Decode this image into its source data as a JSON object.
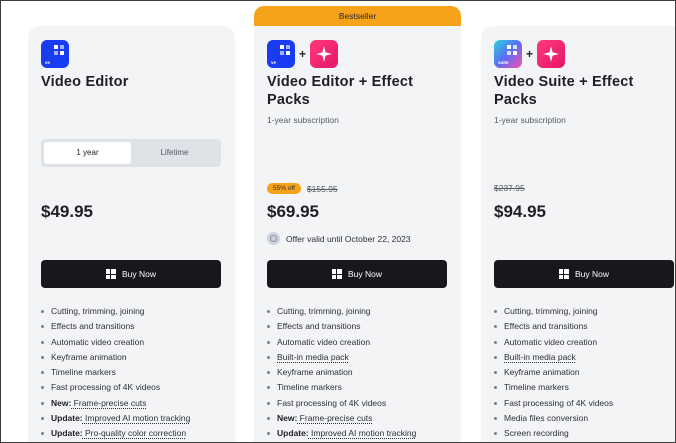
{
  "bestseller_label": "Bestseller",
  "buy_label": "Buy Now",
  "cards": [
    {
      "icon_tags": [
        "ve"
      ],
      "title": "Video Editor",
      "toggle": [
        "1 year",
        "Lifetime"
      ],
      "price": "$49.95",
      "features": [
        {
          "prefix": "",
          "text": "Cutting, trimming, joining",
          "underline": false
        },
        {
          "prefix": "",
          "text": "Effects and transitions",
          "underline": false
        },
        {
          "prefix": "",
          "text": "Automatic video creation",
          "underline": false
        },
        {
          "prefix": "",
          "text": "Keyframe animation",
          "underline": false
        },
        {
          "prefix": "",
          "text": "Timeline markers",
          "underline": false
        },
        {
          "prefix": "",
          "text": "Fast processing of 4K videos",
          "underline": false
        },
        {
          "prefix": "New:",
          "text": " Frame-precise cuts",
          "underline": true
        },
        {
          "prefix": "Update:",
          "text": " Improved AI motion tracking",
          "underline": true
        },
        {
          "prefix": "Update:",
          "text": " Pro-quality color correction",
          "underline": true
        }
      ]
    },
    {
      "icon_tags": [
        "ve"
      ],
      "title": "Video Editor + Effect Packs",
      "subtitle": "1-year subscription",
      "discount_badge": "55% off",
      "old_price": "$155.95",
      "price": "$69.95",
      "offer_text": "Offer valid until October 22, 2023",
      "features": [
        {
          "prefix": "",
          "text": "Cutting, trimming, joining",
          "underline": false
        },
        {
          "prefix": "",
          "text": "Effects and transitions",
          "underline": false
        },
        {
          "prefix": "",
          "text": "Automatic video creation",
          "underline": false
        },
        {
          "prefix": "",
          "text": "Built-in media pack",
          "underline": true
        },
        {
          "prefix": "",
          "text": "Keyframe animation",
          "underline": false
        },
        {
          "prefix": "",
          "text": "Timeline markers",
          "underline": false
        },
        {
          "prefix": "",
          "text": "Fast processing of 4K videos",
          "underline": false
        },
        {
          "prefix": "New:",
          "text": " Frame-precise cuts",
          "underline": true
        },
        {
          "prefix": "Update:",
          "text": " Improved AI motion tracking",
          "underline": true
        }
      ]
    },
    {
      "icon_tags": [
        "suite"
      ],
      "title": "Video Suite + Effect Packs",
      "subtitle": "1-year subscription",
      "old_price": "$237.95",
      "price": "$94.95",
      "features": [
        {
          "prefix": "",
          "text": "Cutting, trimming, joining",
          "underline": false
        },
        {
          "prefix": "",
          "text": "Effects and transitions",
          "underline": false
        },
        {
          "prefix": "",
          "text": "Automatic video creation",
          "underline": false
        },
        {
          "prefix": "",
          "text": "Built-in media pack",
          "underline": true
        },
        {
          "prefix": "",
          "text": "Keyframe animation",
          "underline": false
        },
        {
          "prefix": "",
          "text": "Timeline markers",
          "underline": false
        },
        {
          "prefix": "",
          "text": "Fast processing of 4K videos",
          "underline": false
        },
        {
          "prefix": "",
          "text": "Media files conversion",
          "underline": false
        },
        {
          "prefix": "",
          "text": "Screen recording",
          "underline": false
        }
      ]
    }
  ],
  "icons": {
    "video_editor": "video-editor-app-icon",
    "effects": "effects-sparkle-icon",
    "suite": "video-suite-app-icon",
    "buy": "windows-icon",
    "offer": "clock-icon"
  },
  "colors": {
    "accent_orange": "#f7a21b",
    "video_editor_blue": "#1a3cf0",
    "effects_pink": "#e6146a",
    "buy_button": "#17181b",
    "card_bg": "#f3f4f6"
  }
}
